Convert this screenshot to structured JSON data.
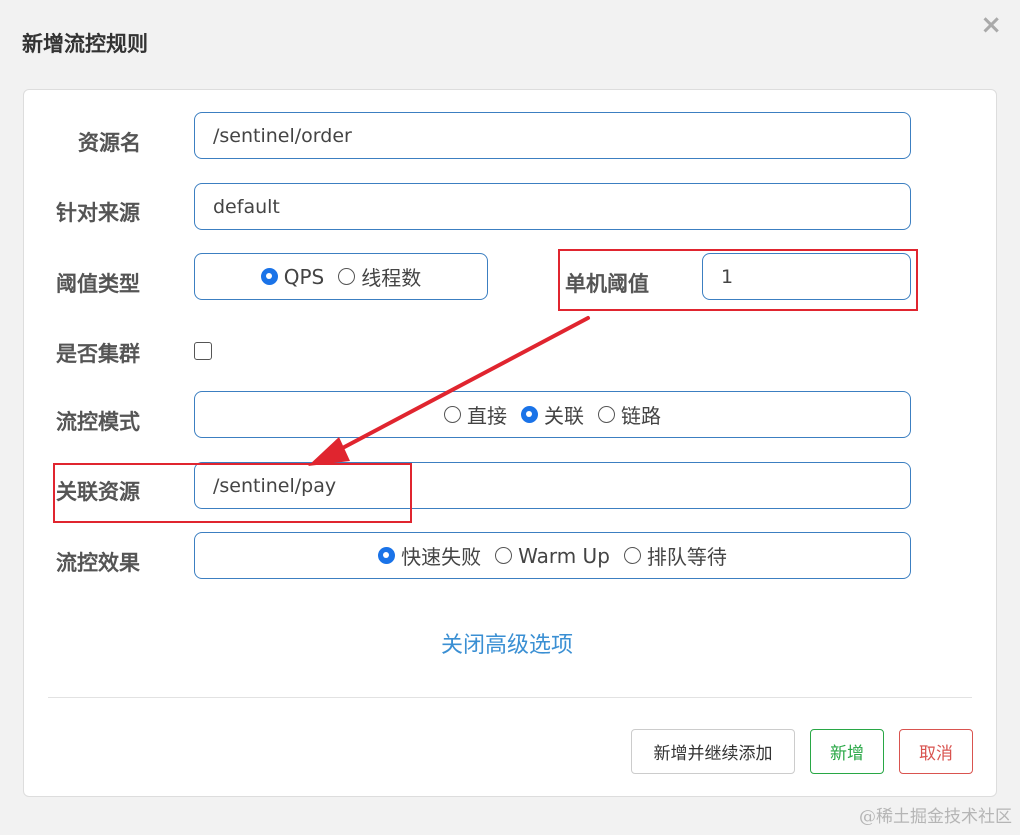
{
  "dialog": {
    "title": "新增流控规则",
    "close_glyph": "×"
  },
  "form": {
    "resource_name": {
      "label": "资源名",
      "value": "/sentinel/order"
    },
    "limit_app": {
      "label": "针对来源",
      "value": "default"
    },
    "grade": {
      "label": "阈值类型",
      "options": [
        "QPS",
        "线程数"
      ],
      "selected": "QPS"
    },
    "count": {
      "label": "单机阈值",
      "value": "1"
    },
    "cluster_mode": {
      "label": "是否集群",
      "checked": false
    },
    "strategy": {
      "label": "流控模式",
      "options": [
        "直接",
        "关联",
        "链路"
      ],
      "selected": "关联"
    },
    "ref_resource": {
      "label": "关联资源",
      "value": "/sentinel/pay"
    },
    "control_behavior": {
      "label": "流控效果",
      "options": [
        "快速失败",
        "Warm Up",
        "排队等待"
      ],
      "selected": "快速失败"
    },
    "advanced_toggle": "关闭高级选项"
  },
  "footer": {
    "add_continue_label": "新增并继续添加",
    "add_label": "新增",
    "cancel_label": "取消"
  },
  "annotation": {
    "highlight_color": "#e0252f"
  },
  "watermark": "@稀土掘金技术社区"
}
